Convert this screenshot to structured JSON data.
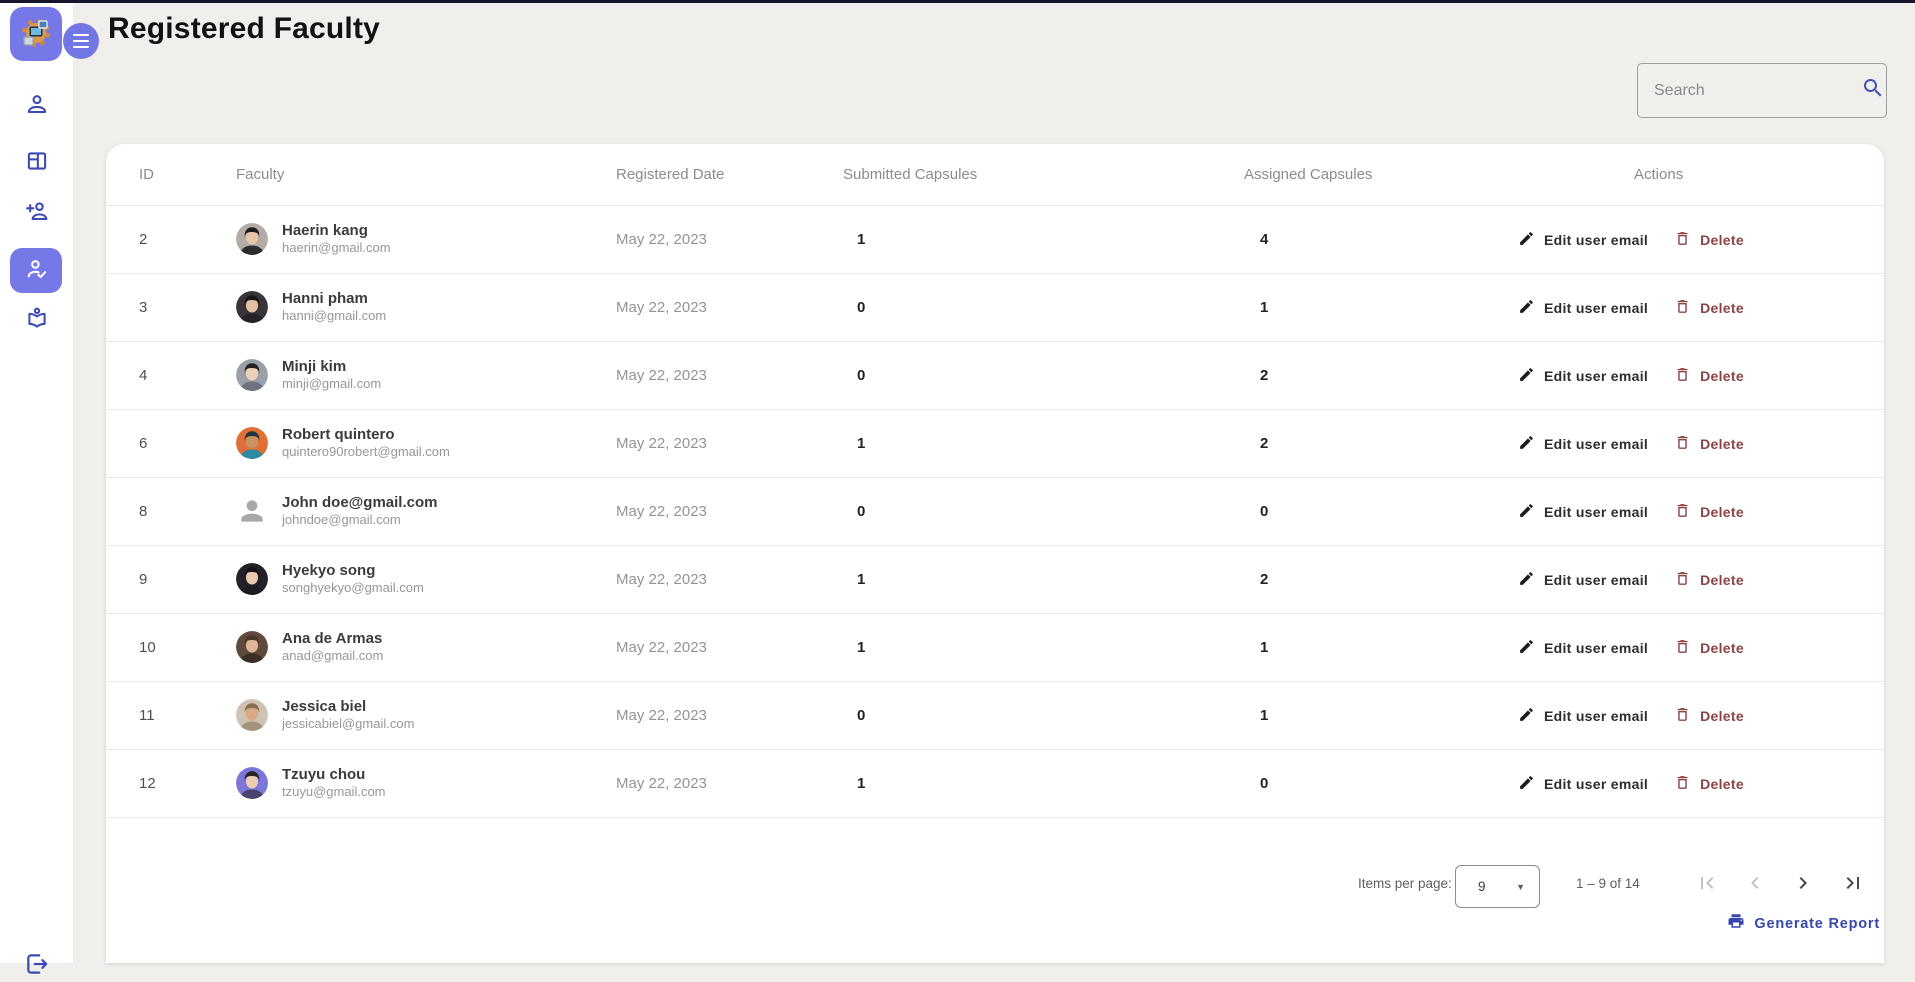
{
  "topbar": {
    "title": "Registered Faculty"
  },
  "search": {
    "placeholder": "Search"
  },
  "colors": {
    "accent_purple": "#7678e8",
    "sidebar_icon_indigo": "#3c4ab5",
    "report_indigo": "#3748ac",
    "delete_maroon": "#8c4343",
    "page_background": "#f1efec"
  },
  "sidebar": {
    "icons": [
      "person-icon",
      "panel-layout-icon",
      "person-add-icon",
      "person-check-icon",
      "library-icon",
      "logout-icon"
    ],
    "selected_index": 3
  },
  "table": {
    "columns": [
      "ID",
      "Faculty",
      "Registered Date",
      "Submitted Capsules",
      "Assigned Capsules",
      "Actions"
    ],
    "actions": {
      "edit_label": "Edit user email",
      "delete_label": "Delete"
    },
    "rows": [
      {
        "id": "2",
        "name": "Haerin kang",
        "email": "haerin@gmail.com",
        "date": "May 22, 2023",
        "submitted": "1",
        "assigned": "4",
        "avatar": {
          "style": "photo",
          "bg": "#b3aca6",
          "hair": "#1f1c1e",
          "skin": "#e8c4a8",
          "shirt": "#2b2b30"
        }
      },
      {
        "id": "3",
        "name": "Hanni pham",
        "email": "hanni@gmail.com",
        "date": "May 22, 2023",
        "submitted": "0",
        "assigned": "1",
        "avatar": {
          "style": "photo",
          "bg": "#3a3438",
          "hair": "#17151a",
          "skin": "#e3bfa4",
          "shirt": "#232227"
        }
      },
      {
        "id": "4",
        "name": "Minji kim",
        "email": "minji@gmail.com",
        "date": "May 22, 2023",
        "submitted": "0",
        "assigned": "2",
        "avatar": {
          "style": "photo",
          "bg": "#9aa0a8",
          "hair": "#24211f",
          "skin": "#ecd0b8",
          "shirt": "#6d737c"
        }
      },
      {
        "id": "6",
        "name": "Robert quintero",
        "email": "quintero90robert@gmail.com",
        "date": "May 22, 2023",
        "submitted": "1",
        "assigned": "2",
        "avatar": {
          "style": "photo",
          "bg": "#de6f36",
          "hair": "#26323a",
          "skin": "#c99261",
          "shirt": "#2e8aa0"
        }
      },
      {
        "id": "8",
        "name": "John doe@gmail.com",
        "email": "johndoe@gmail.com",
        "date": "May 22, 2023",
        "submitted": "0",
        "assigned": "0",
        "avatar": {
          "style": "placeholder"
        }
      },
      {
        "id": "9",
        "name": "Hyekyo song",
        "email": "songhyekyo@gmail.com",
        "date": "May 22, 2023",
        "submitted": "1",
        "assigned": "2",
        "avatar": {
          "style": "photo",
          "bg": "#242028",
          "hair": "#141216",
          "skin": "#edc9ae",
          "shirt": "#1c1a20"
        }
      },
      {
        "id": "10",
        "name": "Ana de Armas",
        "email": "anad@gmail.com",
        "date": "May 22, 2023",
        "submitted": "1",
        "assigned": "1",
        "avatar": {
          "style": "photo",
          "bg": "#5d4a3c",
          "hair": "#4a3629",
          "skin": "#dfb593",
          "shirt": "#3a2e25"
        }
      },
      {
        "id": "11",
        "name": "Jessica biel",
        "email": "jessicabiel@gmail.com",
        "date": "May 22, 2023",
        "submitted": "0",
        "assigned": "1",
        "avatar": {
          "style": "photo",
          "bg": "#cfc3b4",
          "hair": "#8a6f52",
          "skin": "#d9a980",
          "shirt": "#a5937d"
        }
      },
      {
        "id": "12",
        "name": "Tzuyu chou",
        "email": "tzuyu@gmail.com",
        "date": "May 22, 2023",
        "submitted": "1",
        "assigned": "0",
        "avatar": {
          "style": "photo",
          "bg": "#7a77d8",
          "hair": "#2a2326",
          "skin": "#eccdb4",
          "shirt": "#47456e"
        }
      }
    ]
  },
  "paginator": {
    "items_per_page_label": "Items per page:",
    "page_size": "9",
    "range": "1 – 9 of 14"
  },
  "report": {
    "label": "Generate Report"
  }
}
